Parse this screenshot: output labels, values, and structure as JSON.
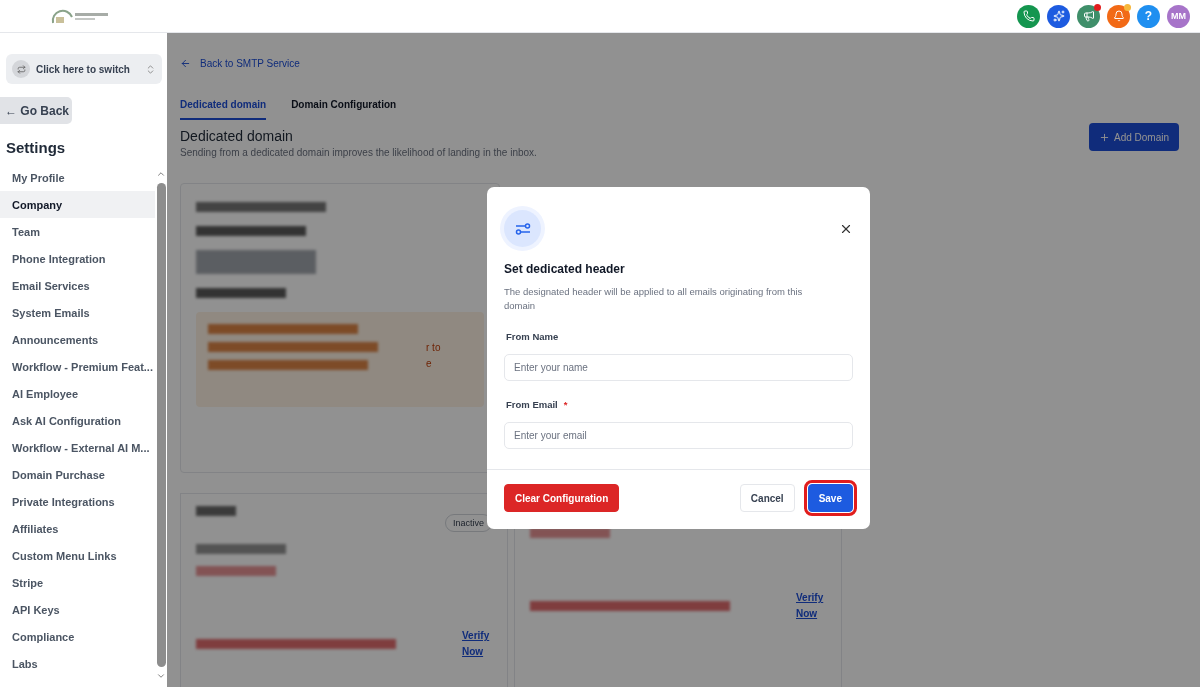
{
  "header": {
    "actions": [
      {
        "kind": "icon",
        "color": "#14964f",
        "dot": false
      },
      {
        "kind": "icon",
        "color": "#1d5be0",
        "dot": false
      },
      {
        "kind": "icon",
        "color": "#3f8f6a",
        "dot": true
      },
      {
        "kind": "icon",
        "color": "#f26a16",
        "dot": true
      },
      {
        "kind": "text",
        "label": "?",
        "color": "#1f8ff0",
        "dot": false
      },
      {
        "kind": "text",
        "label": "MM",
        "color": "#a774c9",
        "dot": false
      }
    ]
  },
  "sidebar": {
    "switcher": "Click here to switch",
    "back": "← Go Back",
    "title": "Settings",
    "items": [
      {
        "label": "My Profile",
        "selected": false
      },
      {
        "label": "Company",
        "selected": true
      },
      {
        "label": "Team",
        "selected": false
      },
      {
        "label": "Phone Integration",
        "selected": false
      },
      {
        "label": "Email Services",
        "selected": false
      },
      {
        "label": "System Emails",
        "selected": false
      },
      {
        "label": "Announcements",
        "selected": false
      },
      {
        "label": "Workflow - Premium Feat...",
        "selected": false
      },
      {
        "label": "AI Employee",
        "selected": false
      },
      {
        "label": "Ask AI Configuration",
        "selected": false
      },
      {
        "label": "Workflow - External AI M...",
        "selected": false
      },
      {
        "label": "Domain Purchase",
        "selected": false
      },
      {
        "label": "Private Integrations",
        "selected": false
      },
      {
        "label": "Affiliates",
        "selected": false
      },
      {
        "label": "Custom Menu Links",
        "selected": false
      },
      {
        "label": "Stripe",
        "selected": false
      },
      {
        "label": "API Keys",
        "selected": false
      },
      {
        "label": "Compliance",
        "selected": false
      },
      {
        "label": "Labs",
        "selected": false
      }
    ]
  },
  "main": {
    "back_link": "Back to SMTP Service",
    "tabs": [
      {
        "label": "Dedicated domain",
        "selected": true
      },
      {
        "label": "Domain Configuration",
        "selected": false
      }
    ],
    "heading": "Dedicated domain",
    "subheading": "Sending from a dedicated domain improves the likelihood of landing in the inbox.",
    "add_button": "Add Domain",
    "card": {
      "fragments": [
        "r to",
        "e"
      ]
    },
    "domain_cards": [
      {
        "badge": "Inactive",
        "link": "Verify Now"
      },
      {
        "link": "Verify Now"
      }
    ]
  },
  "modal": {
    "title": "Set dedicated header",
    "description": "The designated header will be applied to all emails originating from this domain",
    "fields": [
      {
        "label": "From Name",
        "placeholder": "Enter your name",
        "required": false
      },
      {
        "label": "From Email",
        "placeholder": "Enter your email",
        "required": true
      }
    ],
    "required_mark": "*",
    "clear_button": "Clear Configuration",
    "cancel_button": "Cancel",
    "save_button": {
      "label": "Save",
      "highlighted": true
    }
  }
}
